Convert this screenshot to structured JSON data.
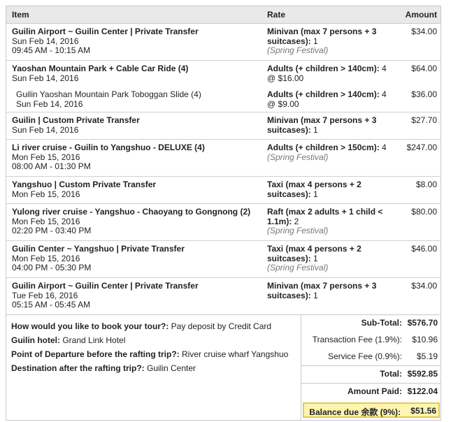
{
  "header": {
    "item": "Item",
    "rate": "Rate",
    "amount": "Amount"
  },
  "rows": [
    {
      "title": "Guilin Airport ~ Guilin Center | Private Transfer",
      "date": "Sun Feb 14, 2016",
      "time": "09:45 AM - 10:15 AM",
      "rate_b": "Minivan (max 7 persons + 3 suitcases):",
      "rate_n": " 1",
      "note": "(Spring Festival)",
      "amount": "$34.00"
    },
    {
      "title": "Yaoshan Mountain Park + Cable Car Ride (4)",
      "date": "Sun Feb 14, 2016",
      "time": "",
      "rate_b": "Adults (+ children > 140cm):",
      "rate_n": " 4 @ $16.00",
      "note": "",
      "amount": "$64.00"
    },
    {
      "title": "Guilin Yaoshan Mountain Park Toboggan Slide (4)",
      "date": "Sun Feb 14, 2016",
      "time": "",
      "rate_b": "Adults (+ children > 140cm):",
      "rate_n": " 4 @ $9.00",
      "note": "",
      "amount": "$36.00"
    },
    {
      "title": "Guilin | Custom Private Transfer",
      "date": "Sun Feb 14, 2016",
      "time": "",
      "rate_b": "Minivan (max 7 persons + 3 suitcases):",
      "rate_n": " 1",
      "note": "",
      "amount": "$27.70"
    },
    {
      "title": "Li river cruise - Guilin to Yangshuo - DELUXE (4)",
      "date": "Mon Feb 15, 2016",
      "time": "08:00 AM - 01:30 PM",
      "rate_b": "Adults (+ children > 150cm):",
      "rate_n": " 4",
      "note": "(Spring Festival)",
      "amount": "$247.00"
    },
    {
      "title": "Yangshuo | Custom Private Transfer",
      "date": "Mon Feb 15, 2016",
      "time": "",
      "rate_b": "Taxi (max 4 persons + 2 suitcases):",
      "rate_n": " 1",
      "note": "",
      "amount": "$8.00"
    },
    {
      "title": "Yulong river cruise - Yangshuo - Chaoyang to Gongnong (2)",
      "date": "Mon Feb 15, 2016",
      "time": "02:20 PM - 03:40 PM",
      "rate_b": "Raft (max 2 adults + 1 child < 1.1m):",
      "rate_n": " 2",
      "note": "(Spring Festival)",
      "amount": "$80.00"
    },
    {
      "title": "Guilin Center ~ Yangshuo | Private Transfer",
      "date": "Mon Feb 15, 2016",
      "time": "04:00 PM - 05:30 PM",
      "rate_b": "Taxi (max 4 persons + 2 suitcases):",
      "rate_n": " 1",
      "note": "(Spring Festival)",
      "amount": "$46.00"
    },
    {
      "title": "Guilin Airport ~ Guilin Center | Private Transfer",
      "date": "Tue Feb 16, 2016",
      "time": "05:15 AM - 05:45 AM",
      "rate_b": "Minivan (max 7 persons + 3 suitcases):",
      "rate_n": " 1",
      "note": "",
      "amount": "$34.00"
    }
  ],
  "qa": [
    {
      "q": "How would you like to book your tour?:",
      "a": " Pay deposit by Credit Card"
    },
    {
      "q": "Guilin hotel:",
      "a": " Grand Link Hotel"
    },
    {
      "q": "Point of Departure before the rafting trip?:",
      "a": " River cruise wharf Yangshuo"
    },
    {
      "q": "Destination after the rafting trip?:",
      "a": " Guilin Center"
    }
  ],
  "totals": {
    "subtotal_label": "Sub-Total:",
    "subtotal": "$576.70",
    "txfee_label": "Transaction Fee (1.9%):",
    "txfee": "$10.96",
    "svcfee_label": "Service Fee (0.9%):",
    "svcfee": "$5.19",
    "total_label": "Total:",
    "total": "$592.85",
    "paid_label": "Amount Paid:",
    "paid": "$122.04",
    "balance_label": "Balance due 余款 (9%):",
    "balance": "$51.56"
  },
  "colors": {
    "header_bg": "#e9e9e9",
    "balance_bg": "#fdf5b0",
    "balance_border": "#e5c94a",
    "note": "#777777"
  }
}
